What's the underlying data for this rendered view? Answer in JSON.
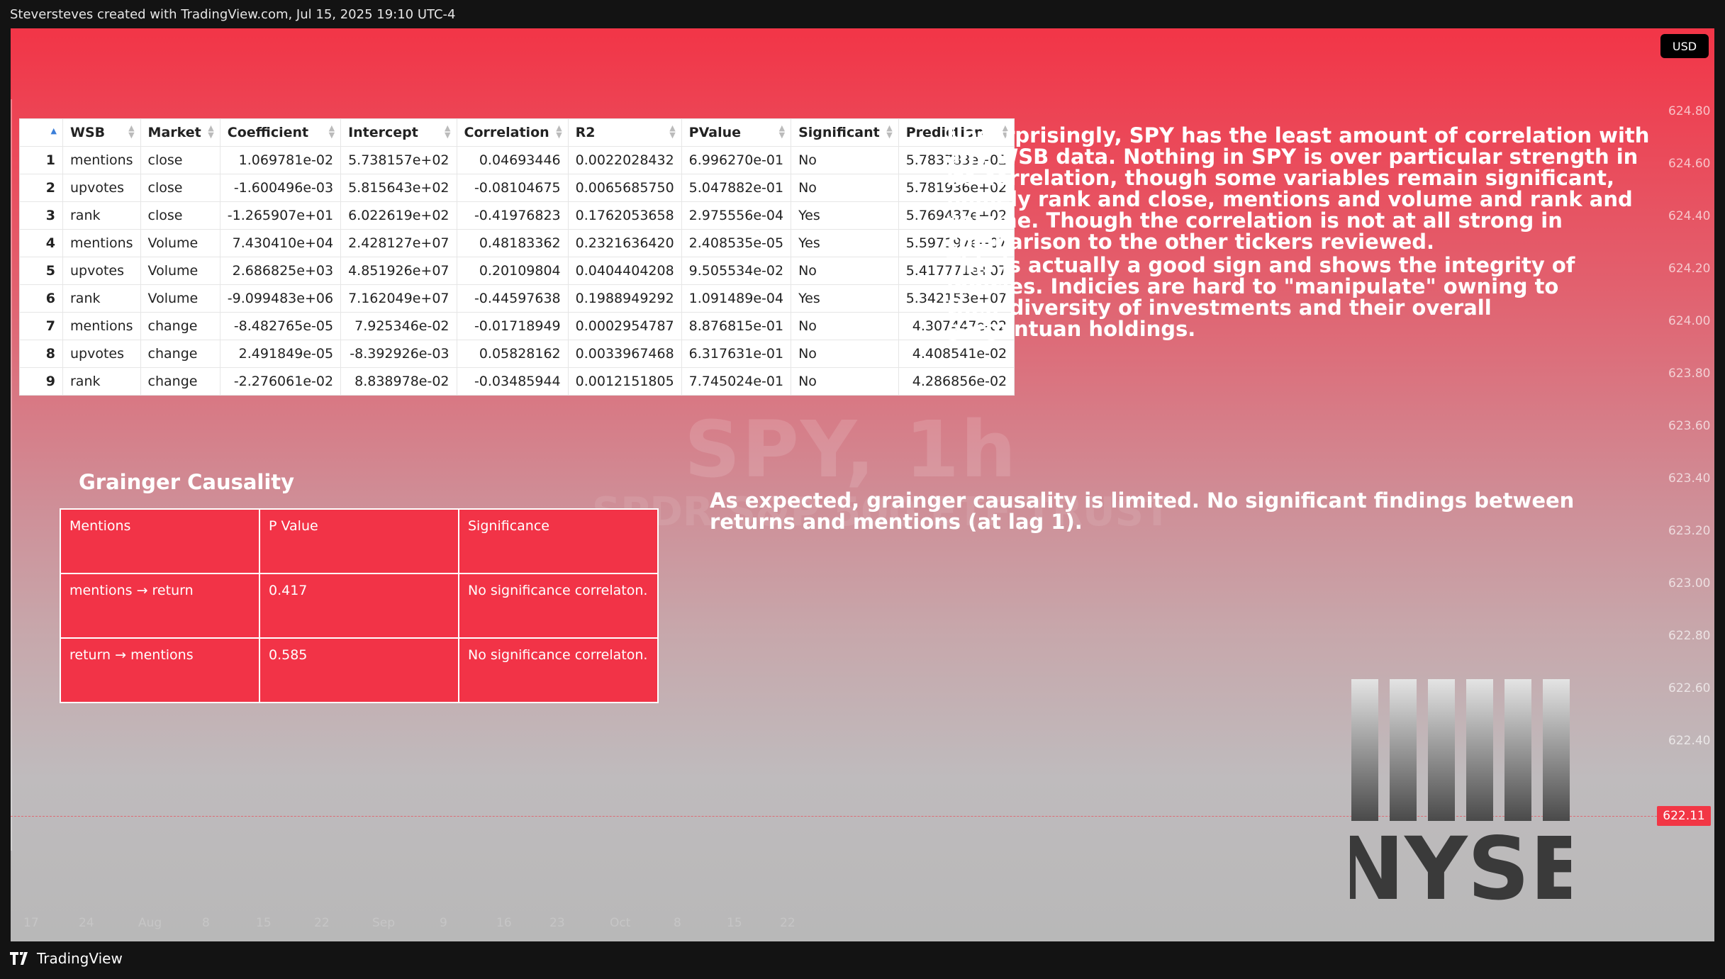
{
  "header": {
    "credit": "Steversteves created with TradingView.com, Jul 15, 2025 19:10 UTC-4"
  },
  "footer": {
    "brand": "TradingView"
  },
  "chart_ui": {
    "currency": "USD",
    "price_axis": [
      "624.80",
      "624.60",
      "624.40",
      "624.20",
      "624.00",
      "623.80",
      "623.60",
      "623.40",
      "623.20",
      "623.00",
      "622.80",
      "622.60",
      "622.40"
    ],
    "current_price": "622.11",
    "watermark_symbol": "SPY, 1h",
    "watermark_name": "SPDR S&P 500 ETF TRUST",
    "time_axis": [
      "17",
      "24",
      "Aug",
      "8",
      "15",
      "22",
      "Sep",
      "9",
      "16",
      "23",
      "Oct",
      "8",
      "15",
      "22"
    ]
  },
  "regression_table": {
    "headers": [
      "WSB",
      "Market",
      "Coefficient",
      "Intercept",
      "Correlation",
      "R2",
      "PValue",
      "Significant",
      "Prediction"
    ],
    "rows": [
      [
        "1",
        "mentions",
        "close",
        "1.069781e-02",
        "5.738157e+02",
        "0.04693446",
        "0.0022028432",
        "6.996270e-01",
        "No",
        "5.783783e+02"
      ],
      [
        "2",
        "upvotes",
        "close",
        "-1.600496e-03",
        "5.815643e+02",
        "-0.08104675",
        "0.0065685750",
        "5.047882e-01",
        "No",
        "5.781936e+02"
      ],
      [
        "3",
        "rank",
        "close",
        "-1.265907e+01",
        "6.022619e+02",
        "-0.41976823",
        "0.1762053658",
        "2.975556e-04",
        "Yes",
        "5.769437e+02"
      ],
      [
        "4",
        "mentions",
        "Volume",
        "7.430410e+04",
        "2.428127e+07",
        "0.48183362",
        "0.2321636420",
        "2.408535e-05",
        "Yes",
        "5.597197e+07"
      ],
      [
        "5",
        "upvotes",
        "Volume",
        "2.686825e+03",
        "4.851926e+07",
        "0.20109804",
        "0.0404404208",
        "9.505534e-02",
        "No",
        "5.417771e+07"
      ],
      [
        "6",
        "rank",
        "Volume",
        "-9.099483e+06",
        "7.162049e+07",
        "-0.44597638",
        "0.1988949292",
        "1.091489e-04",
        "Yes",
        "5.342153e+07"
      ],
      [
        "7",
        "mentions",
        "change",
        "-8.482765e-05",
        "7.925346e-02",
        "-0.01718949",
        "0.0002954787",
        "8.876815e-01",
        "No",
        "4.307447e-02"
      ],
      [
        "8",
        "upvotes",
        "change",
        "2.491849e-05",
        "-8.392926e-03",
        "0.05828162",
        "0.0033967468",
        "6.317631e-01",
        "No",
        "4.408541e-02"
      ],
      [
        "9",
        "rank",
        "change",
        "-2.276061e-02",
        "8.838978e-02",
        "-0.03485944",
        "0.0012151805",
        "7.745024e-01",
        "No",
        "4.286856e-02"
      ]
    ]
  },
  "notes": {
    "p1": "Unsurprisingly, SPY has the least amount of correlation with any WSB data. Nothing in SPY is over particular strength in its correlation, though some variables remain significant, namely rank and close, mentions and volume and rank and volume. Though the correlation is not at all strong in comparison to the other tickers reviewed.",
    "p2": "This is actually a good sign and shows the integrity of indicies. Indicies are hard to \"manipulate\" owning to their diversity of investments and their overall gargantuan holdings.",
    "p3": "As expected, grainger causality is limited. No significant findings between returns and mentions (at lag 1)."
  },
  "granger": {
    "title": "Grainger Causality",
    "headers": [
      "Mentions",
      "P Value",
      "Significance"
    ],
    "rows": [
      [
        "mentions → return",
        "0.417",
        "No significance correlaton."
      ],
      [
        "return → mentions",
        "0.585",
        "No significance correlaton."
      ]
    ]
  },
  "nyse_logo": {
    "text": "NYSE",
    "color": "#3a3a3a"
  }
}
